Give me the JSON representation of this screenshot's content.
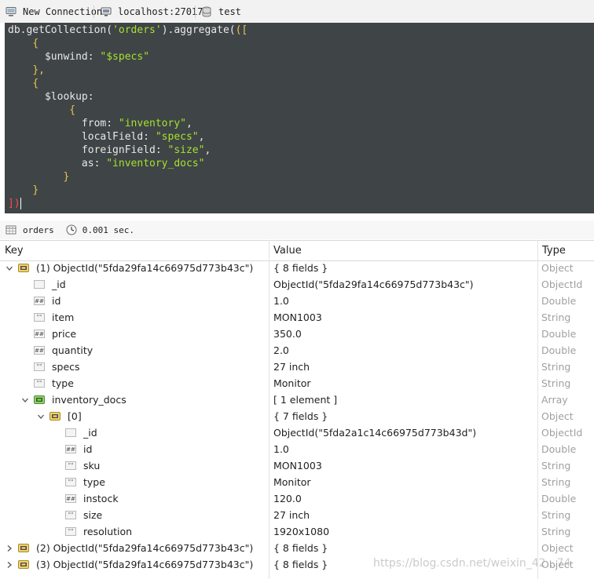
{
  "connection": {
    "name": "New Connection",
    "server": "localhost:27017",
    "database": "test"
  },
  "editor": {
    "lines": [
      [
        [
          "w",
          "db.getCollection("
        ],
        [
          "s",
          "'orders'"
        ],
        [
          "w",
          ").aggregate("
        ],
        [
          "b",
          "(["
        ]
      ],
      [
        [
          "w",
          "    "
        ],
        [
          "b",
          "{"
        ]
      ],
      [
        [
          "w",
          "      $unwind: "
        ],
        [
          "s",
          "\"$specs\""
        ]
      ],
      [
        [
          "w",
          "    "
        ],
        [
          "b",
          "},"
        ]
      ],
      [
        [
          "w",
          "    "
        ],
        [
          "b",
          "{"
        ]
      ],
      [
        [
          "w",
          "      $lookup:"
        ]
      ],
      [
        [
          "w",
          "          "
        ],
        [
          "b",
          "{"
        ]
      ],
      [
        [
          "w",
          "            from: "
        ],
        [
          "s",
          "\"inventory\""
        ],
        [
          "w",
          ","
        ]
      ],
      [
        [
          "w",
          "            localField: "
        ],
        [
          "s",
          "\"specs\""
        ],
        [
          "w",
          ","
        ]
      ],
      [
        [
          "w",
          "            foreignField: "
        ],
        [
          "s",
          "\"size\""
        ],
        [
          "w",
          ","
        ]
      ],
      [
        [
          "w",
          "            as: "
        ],
        [
          "s",
          "\"inventory_docs\""
        ]
      ],
      [
        [
          "w",
          "         "
        ],
        [
          "b",
          "}"
        ]
      ],
      [
        [
          "w",
          "    "
        ],
        [
          "b",
          "}"
        ]
      ],
      [
        [
          "r",
          "])"
        ]
      ]
    ]
  },
  "results": {
    "collection": "orders",
    "time": "0.001 sec."
  },
  "table": {
    "headers": {
      "key": "Key",
      "value": "Value",
      "type": "Type"
    },
    "rows": [
      {
        "level": 0,
        "arrow": "down",
        "icon": "object",
        "key": "(1) ObjectId(\"5fda29fa14c66975d773b43c\")",
        "value": "{ 8 fields }",
        "type": "Object"
      },
      {
        "level": 1,
        "arrow": "none",
        "icon": "id",
        "key": "_id",
        "value": "ObjectId(\"5fda29fa14c66975d773b43c\")",
        "type": "ObjectId"
      },
      {
        "level": 1,
        "arrow": "none",
        "icon": "number",
        "key": "id",
        "value": "1.0",
        "type": "Double"
      },
      {
        "level": 1,
        "arrow": "none",
        "icon": "string",
        "key": "item",
        "value": "MON1003",
        "type": "String"
      },
      {
        "level": 1,
        "arrow": "none",
        "icon": "number",
        "key": "price",
        "value": "350.0",
        "type": "Double"
      },
      {
        "level": 1,
        "arrow": "none",
        "icon": "number",
        "key": "quantity",
        "value": "2.0",
        "type": "Double"
      },
      {
        "level": 1,
        "arrow": "none",
        "icon": "string",
        "key": "specs",
        "value": "27 inch",
        "type": "String"
      },
      {
        "level": 1,
        "arrow": "none",
        "icon": "string",
        "key": "type",
        "value": "Monitor",
        "type": "String"
      },
      {
        "level": 1,
        "arrow": "down",
        "icon": "array",
        "key": "inventory_docs",
        "value": "[ 1 element ]",
        "type": "Array"
      },
      {
        "level": 2,
        "arrow": "down",
        "icon": "object",
        "key": "[0]",
        "value": "{ 7 fields }",
        "type": "Object"
      },
      {
        "level": 3,
        "arrow": "none",
        "icon": "id",
        "key": "_id",
        "value": "ObjectId(\"5fda2a1c14c66975d773b43d\")",
        "type": "ObjectId"
      },
      {
        "level": 3,
        "arrow": "none",
        "icon": "number",
        "key": "id",
        "value": "1.0",
        "type": "Double"
      },
      {
        "level": 3,
        "arrow": "none",
        "icon": "string",
        "key": "sku",
        "value": "MON1003",
        "type": "String"
      },
      {
        "level": 3,
        "arrow": "none",
        "icon": "string",
        "key": "type",
        "value": "Monitor",
        "type": "String"
      },
      {
        "level": 3,
        "arrow": "none",
        "icon": "number",
        "key": "instock",
        "value": "120.0",
        "type": "Double"
      },
      {
        "level": 3,
        "arrow": "none",
        "icon": "string",
        "key": "size",
        "value": "27 inch",
        "type": "String"
      },
      {
        "level": 3,
        "arrow": "none",
        "icon": "string",
        "key": "resolution",
        "value": "1920x1080",
        "type": "String"
      },
      {
        "level": 0,
        "arrow": "right",
        "icon": "object",
        "key": "(2) ObjectId(\"5fda29fa14c66975d773b43c\")",
        "value": "{ 8 fields }",
        "type": "Object"
      },
      {
        "level": 0,
        "arrow": "right",
        "icon": "object",
        "key": "(3) ObjectId(\"5fda29fa14c66975d773b43c\")",
        "value": "{ 8 fields }",
        "type": "Object"
      }
    ]
  },
  "watermark": "https://blog.csdn.net/weixin_42…74",
  "colors": {
    "editor_bg": "#3f4447",
    "string": "#a6e22e",
    "bracket": "#e6c54c",
    "type_text": "#a0a0a0"
  }
}
